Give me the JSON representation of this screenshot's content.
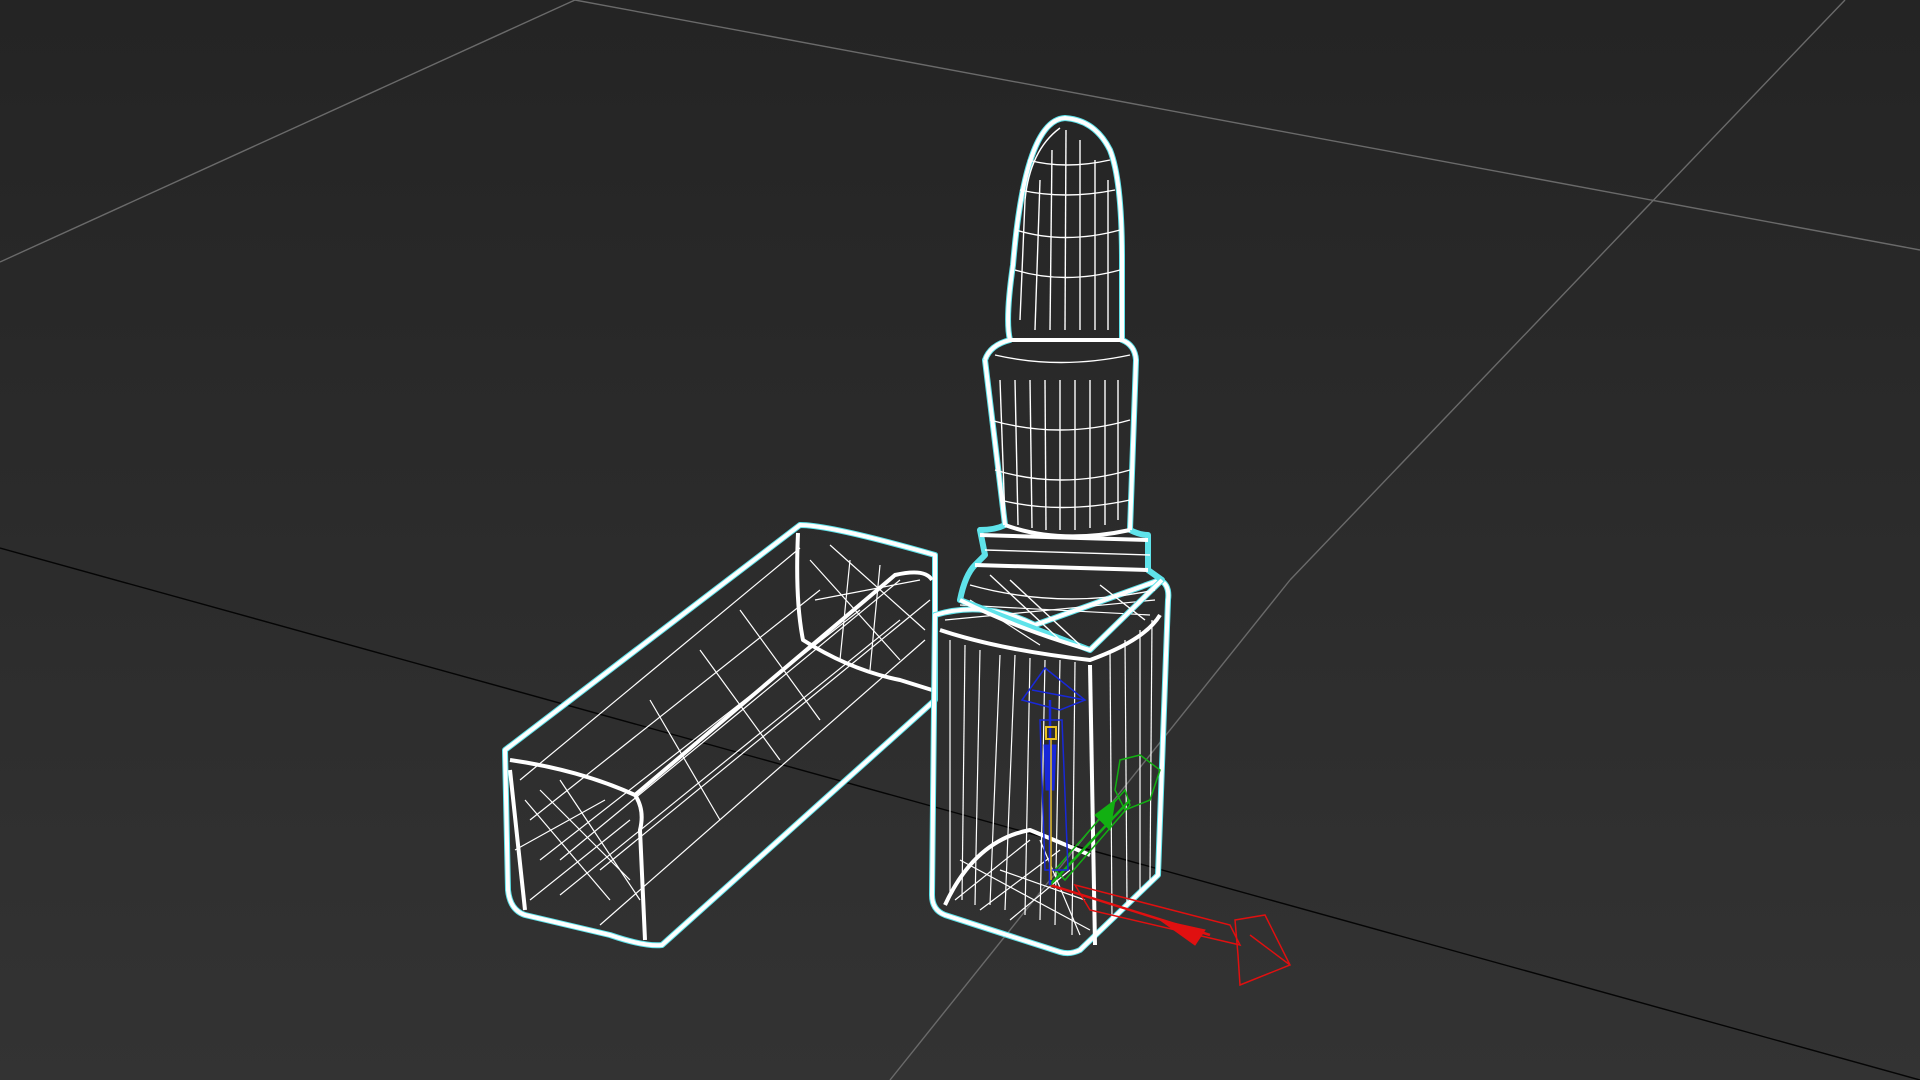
{
  "viewport": {
    "background_top": "#242424",
    "background_bottom": "#333333",
    "grid_color": "#6a6a6a",
    "grid_axis_color": "#050505",
    "selection_outline_color": "#5fe3ea",
    "wireframe_color": "#ffffff"
  },
  "scene": {
    "objects": [
      {
        "name": "lipstick-cap",
        "selected": true
      },
      {
        "name": "lipstick-base",
        "selected": true
      },
      {
        "name": "lipstick-bullet",
        "selected": true
      }
    ]
  },
  "gizmo": {
    "type": "move",
    "axes": [
      {
        "axis": "x",
        "color": "#e01010"
      },
      {
        "axis": "y",
        "color": "#12b012"
      },
      {
        "axis": "z",
        "color": "#1828d8"
      }
    ],
    "pivot_color": "#e8c020"
  }
}
